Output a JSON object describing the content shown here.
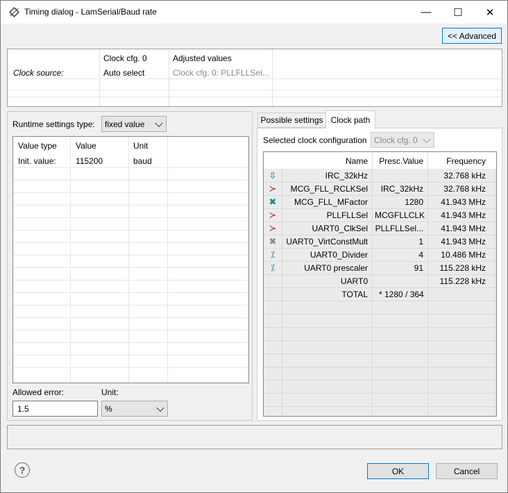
{
  "window": {
    "title": "Timing dialog - LamSerial/Baud rate",
    "minimize_glyph": "—",
    "maximize_glyph": "☐",
    "close_glyph": "✕"
  },
  "advanced_button": "<< Advanced",
  "clock_source_table": {
    "row_label": "Clock source:",
    "col1_header": "Clock cfg. 0",
    "col1_value": "Auto select",
    "col2_header": "Adjusted values",
    "col2_value": "Clock cfg. 0: PLLFLLSel..."
  },
  "runtime": {
    "label": "Runtime settings type:",
    "selected": "fixed value",
    "headers": [
      "Value type",
      "Value",
      "Unit"
    ],
    "rows": [
      [
        "Init. value:",
        "115200",
        "baud"
      ]
    ]
  },
  "allowed_error": {
    "label": "Allowed error:",
    "value": "1.5",
    "unit_label": "Unit:",
    "unit_value": "%"
  },
  "tabs": [
    "Possible settings",
    "Clock path"
  ],
  "clock_path": {
    "selected_cfg_label": "Selected clock configuration",
    "selected_cfg_value": "Clock cfg. 0",
    "headers": [
      "Name",
      "Presc.Value",
      "Frequency"
    ],
    "rows": [
      {
        "icon": "clock-source-icon",
        "glyph": "⇳",
        "color": "#2f6fb5",
        "name": "IRC_32kHz",
        "presc": "",
        "freq": "32.768 kHz"
      },
      {
        "icon": "selector-icon",
        "glyph": "≻",
        "color": "#b02a2a",
        "name": "MCG_FLL_RCLKSel",
        "presc": "IRC_32kHz",
        "freq": "32.768 kHz"
      },
      {
        "icon": "multiplier-icon",
        "glyph": "✖",
        "color": "#1a8a8a",
        "name": "MCG_FLL_MFactor",
        "presc": "1280",
        "freq": "41.943 MHz"
      },
      {
        "icon": "selector-icon",
        "glyph": "≻",
        "color": "#b02a2a",
        "name": "PLLFLLSel",
        "presc": "MCGFLLCLK",
        "freq": "41.943 MHz"
      },
      {
        "icon": "selector-icon",
        "glyph": "≻",
        "color": "#b02a2a",
        "name": "UART0_ClkSel",
        "presc": "PLLFLLSel...",
        "freq": "41.943 MHz"
      },
      {
        "icon": "multiplier-disabled-icon",
        "glyph": "✖",
        "color": "#8a8a8a",
        "name": "UART0_VirtConstMult",
        "presc": "1",
        "freq": "41.943 MHz"
      },
      {
        "icon": "divider-icon",
        "glyph": "⁒",
        "color": "#1a8a8a",
        "name": "UART0_Divider",
        "presc": "4",
        "freq": "10.486 MHz"
      },
      {
        "icon": "divider-icon",
        "glyph": "⁒",
        "color": "#1a8a8a",
        "name": "UART0 prescaler",
        "presc": "91",
        "freq": "115.228 kHz"
      },
      {
        "icon": "",
        "glyph": "",
        "color": "#000000",
        "name": "UART0",
        "presc": "",
        "freq": "115.228 kHz"
      },
      {
        "icon": "",
        "glyph": "",
        "color": "#000000",
        "name": "TOTAL",
        "presc": "* 1280 / 364",
        "freq": ""
      }
    ]
  },
  "footer": {
    "help_glyph": "?",
    "ok": "OK",
    "cancel": "Cancel"
  },
  "colors": {
    "accent_border": "#0078d7",
    "selected_button_bg": "#e5f1fb"
  }
}
